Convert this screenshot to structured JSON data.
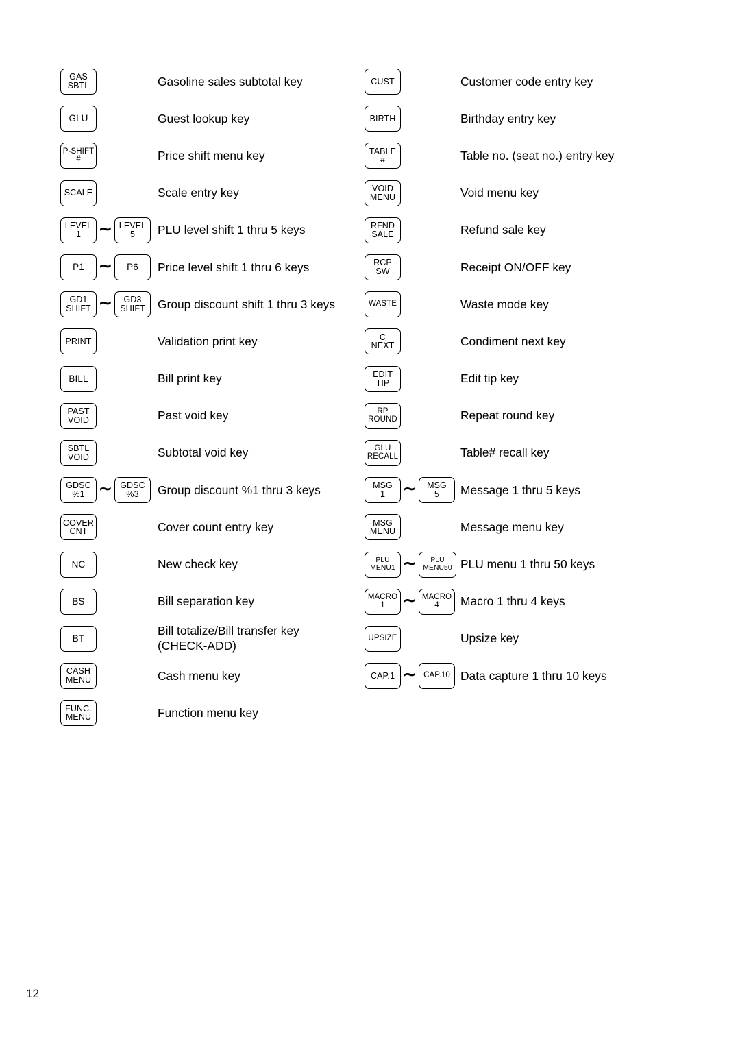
{
  "page": {
    "number": "12"
  },
  "columns": {
    "left": [
      {
        "keys": [
          {
            "lines": [
              "GAS",
              "SBTL"
            ],
            "size": "fs-12",
            "width": "w-std"
          }
        ],
        "description": "Gasoline sales subtotal key"
      },
      {
        "keys": [
          {
            "lines": [
              "GLU"
            ],
            "size": "fs-13",
            "width": "w-std"
          }
        ],
        "description": "Guest lookup key"
      },
      {
        "keys": [
          {
            "lines": [
              "P-SHIFT",
              "#"
            ],
            "size": "fs-11",
            "width": "w-std"
          }
        ],
        "description": "Price shift menu key"
      },
      {
        "keys": [
          {
            "lines": [
              "SCALE"
            ],
            "size": "fs-12",
            "width": "w-std"
          }
        ],
        "description": "Scale entry key"
      },
      {
        "keys": [
          {
            "lines": [
              "LEVEL",
              "1"
            ],
            "size": "fs-12",
            "width": "w-std"
          },
          {
            "separator": "∼"
          },
          {
            "lines": [
              "LEVEL",
              "5"
            ],
            "size": "fs-12",
            "width": "w-std"
          }
        ],
        "description": "PLU level shift 1 thru 5 keys"
      },
      {
        "keys": [
          {
            "lines": [
              "P1"
            ],
            "size": "fs-13",
            "width": "w-std"
          },
          {
            "separator": "∼"
          },
          {
            "lines": [
              "P6"
            ],
            "size": "fs-13",
            "width": "w-std"
          }
        ],
        "description": "Price level shift 1 thru 6 keys"
      },
      {
        "keys": [
          {
            "lines": [
              "GD1",
              "SHIFT"
            ],
            "size": "fs-12",
            "width": "w-std"
          },
          {
            "separator": "∼"
          },
          {
            "lines": [
              "GD3",
              "SHIFT"
            ],
            "size": "fs-12",
            "width": "w-std"
          }
        ],
        "description": "Group discount shift 1 thru 3 keys"
      },
      {
        "keys": [
          {
            "lines": [
              "PRINT"
            ],
            "size": "fs-12",
            "width": "w-std"
          }
        ],
        "description": "Validation print key"
      },
      {
        "keys": [
          {
            "lines": [
              "BILL"
            ],
            "size": "fs-13",
            "width": "w-std"
          }
        ],
        "description": "Bill print key"
      },
      {
        "keys": [
          {
            "lines": [
              "PAST",
              "VOID"
            ],
            "size": "fs-12",
            "width": "w-std"
          }
        ],
        "description": "Past void key"
      },
      {
        "keys": [
          {
            "lines": [
              "SBTL",
              "VOID"
            ],
            "size": "fs-12",
            "width": "w-std"
          }
        ],
        "description": "Subtotal void key"
      },
      {
        "keys": [
          {
            "lines": [
              "GDSC",
              "%1"
            ],
            "size": "fs-12",
            "width": "w-std"
          },
          {
            "separator": "∼"
          },
          {
            "lines": [
              "GDSC",
              "%3"
            ],
            "size": "fs-12",
            "width": "w-std"
          }
        ],
        "description": "Group discount %1 thru 3 keys"
      },
      {
        "keys": [
          {
            "lines": [
              "COVER",
              "CNT"
            ],
            "size": "fs-12",
            "width": "w-std"
          }
        ],
        "description": "Cover count entry key"
      },
      {
        "keys": [
          {
            "lines": [
              "NC"
            ],
            "size": "fs-13",
            "width": "w-std"
          }
        ],
        "description": "New check key"
      },
      {
        "keys": [
          {
            "lines": [
              "BS"
            ],
            "size": "fs-13",
            "width": "w-std"
          }
        ],
        "description": "Bill separation key"
      },
      {
        "keys": [
          {
            "lines": [
              "BT"
            ],
            "size": "fs-13",
            "width": "w-std"
          }
        ],
        "description": "Bill totalize/Bill transfer key\n(CHECK-ADD)",
        "two_line": true
      },
      {
        "keys": [
          {
            "lines": [
              "CASH",
              "MENU"
            ],
            "size": "fs-12",
            "width": "w-std"
          }
        ],
        "description": "Cash menu key"
      },
      {
        "keys": [
          {
            "lines": [
              "FUNC.",
              "MENU"
            ],
            "size": "fs-12",
            "width": "w-std"
          }
        ],
        "description": "Function menu key"
      }
    ],
    "right": [
      {
        "keys": [
          {
            "lines": [
              "CUST"
            ],
            "size": "fs-12",
            "width": "w-std"
          }
        ],
        "description": "Customer code entry key"
      },
      {
        "keys": [
          {
            "lines": [
              "BIRTH"
            ],
            "size": "fs-12",
            "width": "w-std"
          }
        ],
        "description": "Birthday entry key"
      },
      {
        "keys": [
          {
            "lines": [
              "TABLE",
              "#"
            ],
            "size": "fs-12",
            "width": "w-std"
          }
        ],
        "description": "Table no. (seat no.) entry key"
      },
      {
        "keys": [
          {
            "lines": [
              "VOID",
              "MENU"
            ],
            "size": "fs-12",
            "width": "w-std"
          }
        ],
        "description": "Void menu key"
      },
      {
        "keys": [
          {
            "lines": [
              "RFND",
              "SALE"
            ],
            "size": "fs-12",
            "width": "w-std"
          }
        ],
        "description": "Refund sale key"
      },
      {
        "keys": [
          {
            "lines": [
              "RCP",
              "SW"
            ],
            "size": "fs-12",
            "width": "w-std"
          }
        ],
        "description": "Receipt ON/OFF key"
      },
      {
        "keys": [
          {
            "lines": [
              "WASTE"
            ],
            "size": "fs-11",
            "width": "w-std"
          }
        ],
        "description": "Waste mode key"
      },
      {
        "keys": [
          {
            "lines": [
              "C",
              "NEXT"
            ],
            "size": "fs-12",
            "width": "w-std"
          }
        ],
        "description": "Condiment next key"
      },
      {
        "keys": [
          {
            "lines": [
              "EDIT",
              "TIP"
            ],
            "size": "fs-12",
            "width": "w-std"
          }
        ],
        "description": "Edit tip key"
      },
      {
        "keys": [
          {
            "lines": [
              "RP",
              "ROUND"
            ],
            "size": "fs-11",
            "width": "w-std"
          }
        ],
        "description": "Repeat round key"
      },
      {
        "keys": [
          {
            "lines": [
              "GLU",
              "RECALL"
            ],
            "size": "fs-11",
            "width": "w-std"
          }
        ],
        "description": "Table# recall key"
      },
      {
        "keys": [
          {
            "lines": [
              "MSG",
              "1"
            ],
            "size": "fs-12",
            "width": "w-std"
          },
          {
            "separator": "∼"
          },
          {
            "lines": [
              "MSG",
              "5"
            ],
            "size": "fs-12",
            "width": "w-std"
          }
        ],
        "description": "Message 1 thru 5 keys"
      },
      {
        "keys": [
          {
            "lines": [
              "MSG",
              "MENU"
            ],
            "size": "fs-12",
            "width": "w-std"
          }
        ],
        "description": "Message menu key"
      },
      {
        "keys": [
          {
            "lines": [
              "PLU",
              "MENU1"
            ],
            "size": "fs-10",
            "width": "w-std"
          },
          {
            "separator": "∼"
          },
          {
            "lines": [
              "PLU",
              "MENU50"
            ],
            "size": "fs-10",
            "width": "w-wide"
          }
        ],
        "description": "PLU menu 1 thru 50 keys"
      },
      {
        "keys": [
          {
            "lines": [
              "MACRO",
              "1"
            ],
            "size": "fs-11",
            "width": "w-std"
          },
          {
            "separator": "∼"
          },
          {
            "lines": [
              "MACRO",
              "4"
            ],
            "size": "fs-11",
            "width": "w-std"
          }
        ],
        "description": "Macro 1 thru 4 keys"
      },
      {
        "keys": [
          {
            "lines": [
              "UPSIZE"
            ],
            "size": "fs-11",
            "width": "w-std"
          }
        ],
        "description": "Upsize key"
      },
      {
        "keys": [
          {
            "lines": [
              "CAP.1"
            ],
            "size": "fs-12",
            "width": "w-std"
          },
          {
            "separator": "∼"
          },
          {
            "lines": [
              "CAP.10"
            ],
            "size": "fs-11",
            "width": "w-std"
          }
        ],
        "description": "Data capture 1 thru 10 keys"
      }
    ]
  }
}
